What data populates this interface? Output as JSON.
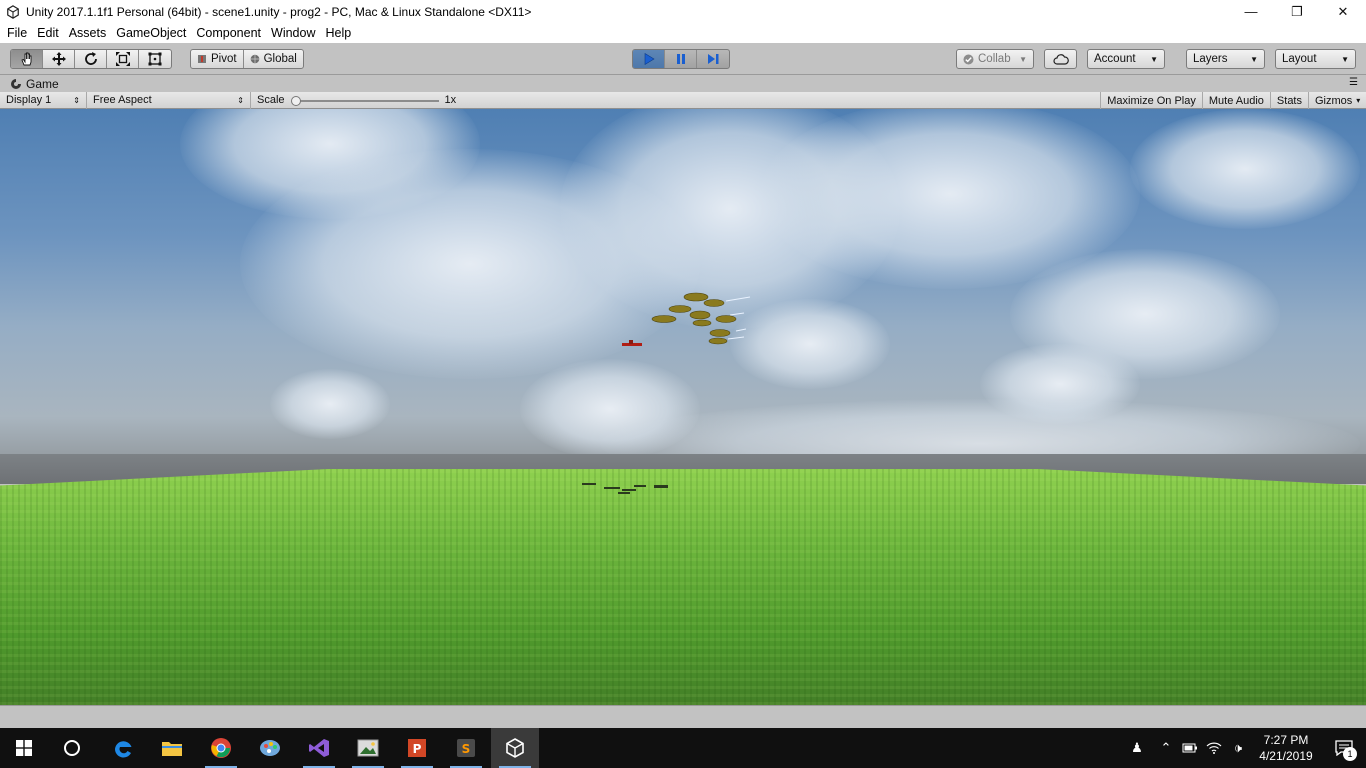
{
  "window": {
    "title": "Unity 2017.1.1f1 Personal (64bit) - scene1.unity - prog2 - PC, Mac & Linux Standalone <DX11>",
    "minimize_glyph": "—",
    "restore_glyph": "❐",
    "close_glyph": "✕"
  },
  "menu": [
    "File",
    "Edit",
    "Assets",
    "GameObject",
    "Component",
    "Window",
    "Help"
  ],
  "toolbar": {
    "tools": [
      "hand-tool-icon",
      "move-tool-icon",
      "rotate-tool-icon",
      "scale-tool-icon",
      "rect-tool-icon"
    ],
    "pivot_label": "Pivot",
    "global_label": "Global",
    "collab_label": "Collab",
    "account_label": "Account",
    "layers_label": "Layers",
    "layout_label": "Layout",
    "play_state": "playing"
  },
  "game_panel": {
    "tab_label": "Game",
    "display_label": "Display 1",
    "aspect_label": "Free Aspect",
    "scale_label": "Scale",
    "scale_value": "1x",
    "maximize_label": "Maximize On Play",
    "mute_label": "Mute Audio",
    "stats_label": "Stats",
    "gizmos_label": "Gizmos"
  },
  "taskbar": {
    "apps": [
      "search-cortana",
      "edge",
      "file-explorer",
      "chrome",
      "paint",
      "visual-studio",
      "photo-viewer",
      "powerpoint",
      "sublime-text",
      "unity"
    ],
    "active_app": "unity",
    "time": "7:27 PM",
    "date": "4/21/2019",
    "notification_count": "1"
  },
  "colors": {
    "play_blue": "#4e78aa",
    "editor_gray": "#c2c2c2",
    "taskbar": "#101010"
  }
}
